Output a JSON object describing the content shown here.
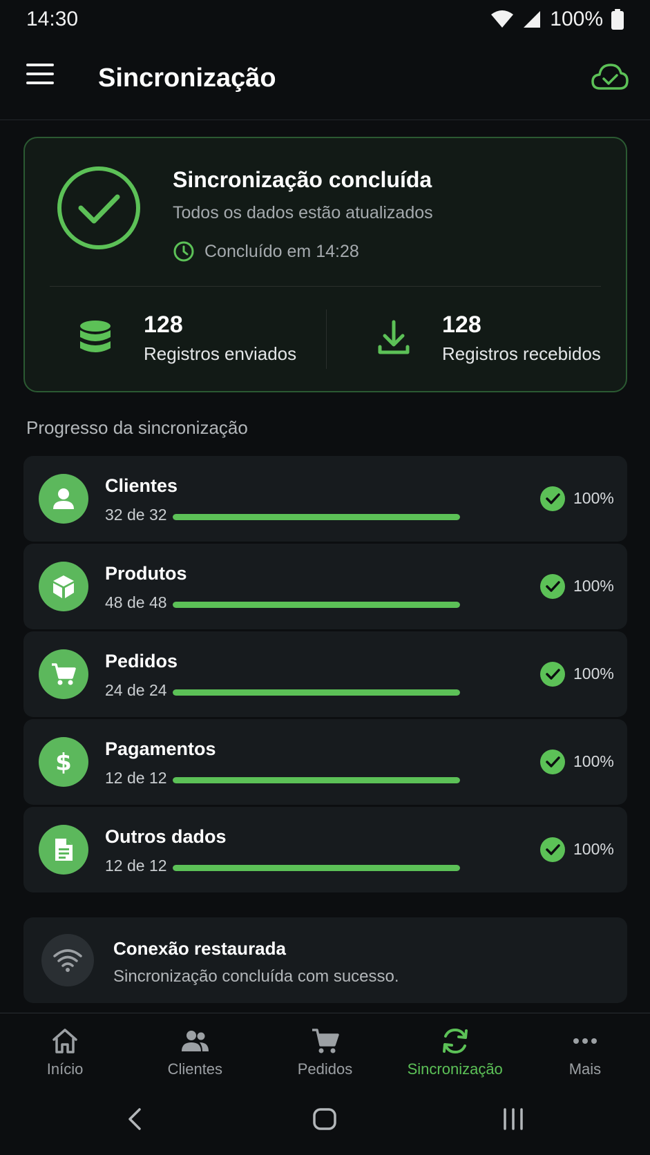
{
  "status": {
    "time": "14:30",
    "battery": "100%"
  },
  "app_bar": {
    "title": "Sincronização"
  },
  "summary": {
    "title": "Sincronização concluída",
    "subtitle": "Todos os dados estão atualizados",
    "completed_at": "Concluído em 14:28",
    "sent_value": "128",
    "sent_label": "Registros enviados",
    "received_value": "128",
    "received_label": "Registros recebidos"
  },
  "section": {
    "heading": "Progresso da sincronização"
  },
  "progress": {
    "items": [
      {
        "title": "Clientes",
        "count": "32 de 32",
        "percent": "100%",
        "fraction": 1.0,
        "icon": "person-icon"
      },
      {
        "title": "Produtos",
        "count": "48 de 48",
        "percent": "100%",
        "fraction": 1.0,
        "icon": "box-icon"
      },
      {
        "title": "Pedidos",
        "count": "24 de 24",
        "percent": "100%",
        "fraction": 1.0,
        "icon": "cart-icon"
      },
      {
        "title": "Pagamentos",
        "count": "12 de 12",
        "percent": "100%",
        "fraction": 1.0,
        "icon": "dollar-icon"
      },
      {
        "title": "Outros dados",
        "count": "12 de 12",
        "percent": "100%",
        "fraction": 1.0,
        "icon": "document-icon"
      }
    ]
  },
  "connection": {
    "title": "Conexão restaurada",
    "subtitle": "Sincronização concluída com sucesso."
  },
  "nav": {
    "items": [
      {
        "label": "Início",
        "icon": "home-icon"
      },
      {
        "label": "Clientes",
        "icon": "people-icon"
      },
      {
        "label": "Pedidos",
        "icon": "cart-icon"
      },
      {
        "label": "Sincronização",
        "icon": "sync-icon",
        "active": true
      },
      {
        "label": "Mais",
        "icon": "more-icon"
      }
    ]
  },
  "colors": {
    "accent": "#5cc157",
    "background": "#0c0e10",
    "card": "#171b1e"
  }
}
